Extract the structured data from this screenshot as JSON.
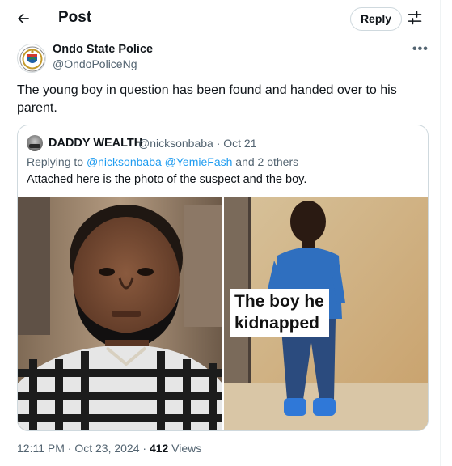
{
  "header": {
    "title": "Post",
    "reply_label": "Reply"
  },
  "author": {
    "name": "Ondo State Police",
    "handle": "@OndoPoliceNg",
    "more": "•••"
  },
  "tweet": {
    "text": "The young boy in question has been found and handed over to his parent."
  },
  "quote": {
    "name": "DADDY WEALTH",
    "handle_date": "@nicksonbaba · Oct 21",
    "replying_prefix": "Replying to ",
    "replying_users": "@nicksonbaba @YemieFash",
    "replying_suffix": " and 2 others",
    "text": "Attached here is the photo of the suspect and the boy.",
    "caption_line1": "The boy he",
    "caption_line2": "kidnapped"
  },
  "footer": {
    "time": "12:11 PM · Oct 23, 2024 · ",
    "views_count": "412",
    "views_label": " Views"
  },
  "colors": {
    "accent": "#1d9bf0",
    "secondary_text": "#536471",
    "border": "#cfd9de"
  },
  "icons": {
    "back": "arrow-left-icon",
    "tune": "sliders-icon",
    "more": "ellipsis-icon"
  }
}
